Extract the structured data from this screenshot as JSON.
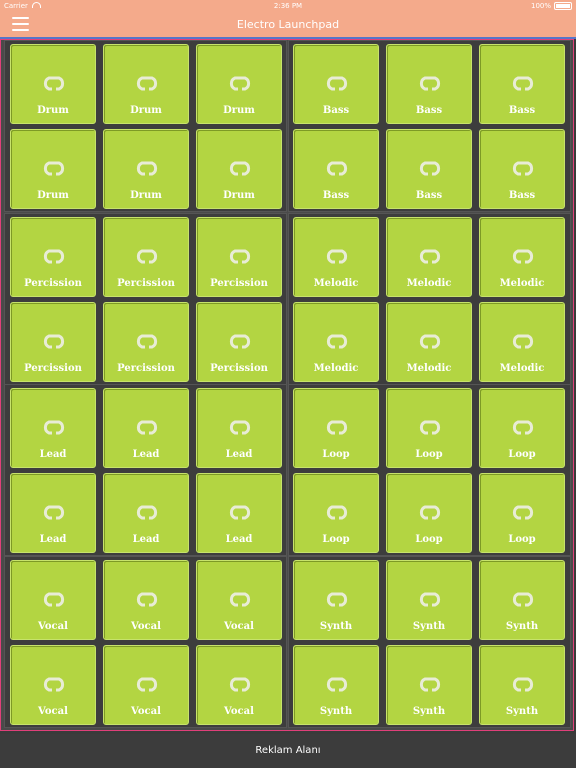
{
  "status": {
    "carrier": "Carrier",
    "time": "2:36 PM",
    "battery": "100%"
  },
  "nav": {
    "title": "Electro Launchpad"
  },
  "pads": [
    [
      "Drum",
      "Drum",
      "Drum",
      "Bass",
      "Bass",
      "Bass"
    ],
    [
      "Drum",
      "Drum",
      "Drum",
      "Bass",
      "Bass",
      "Bass"
    ],
    [
      "Percission",
      "Percission",
      "Percission",
      "Melodic",
      "Melodic",
      "Melodic"
    ],
    [
      "Percission",
      "Percission",
      "Percission",
      "Melodic",
      "Melodic",
      "Melodic"
    ],
    [
      "Lead",
      "Lead",
      "Lead",
      "Loop",
      "Loop",
      "Loop"
    ],
    [
      "Lead",
      "Lead",
      "Lead",
      "Loop",
      "Loop",
      "Loop"
    ],
    [
      "Vocal",
      "Vocal",
      "Vocal",
      "Synth",
      "Synth",
      "Synth"
    ],
    [
      "Vocal",
      "Vocal",
      "Vocal",
      "Synth",
      "Synth",
      "Synth"
    ]
  ],
  "footer": {
    "label": "Reklam Alanı"
  },
  "colors": {
    "pad": "#b3d542",
    "header": "#f4aa8b",
    "border": "#e0407a"
  },
  "icons": {
    "pad": "loop-ring-icon",
    "menu": "hamburger-icon"
  }
}
